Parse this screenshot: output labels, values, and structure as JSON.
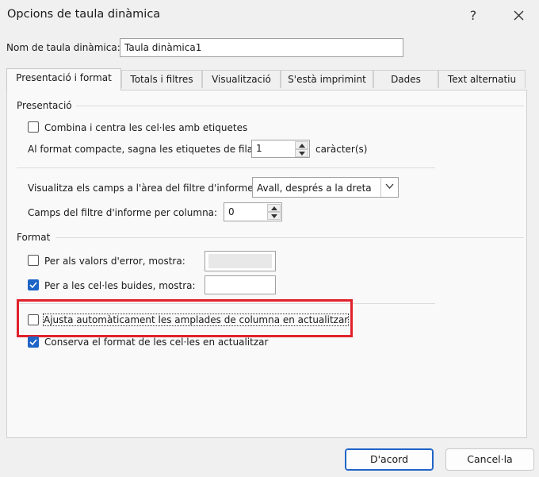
{
  "window": {
    "title": "Opcions de taula dinàmica",
    "help_label": "?"
  },
  "name_field": {
    "label": "Nom de taula dinàmica:",
    "value": "Taula dinàmica1"
  },
  "tabs": [
    {
      "label": "Presentació i format",
      "active": true
    },
    {
      "label": "Totals i filtres"
    },
    {
      "label": "Visualització"
    },
    {
      "label": "S'està imprimint"
    },
    {
      "label": "Dades"
    },
    {
      "label": "Text alternatiu"
    }
  ],
  "presentacio": {
    "title": "Presentació",
    "combine_label": "Combina i centra les cel·les amb etiquetes",
    "combine_checked": false,
    "compact_label": "Al format compacte, sagna les etiquetes de fila:",
    "compact_value": "1",
    "compact_unit": "caràcter(s)",
    "report_filter_label": "Visualitza els camps a l'àrea del filtre d'informe:",
    "report_filter_value": "Avall, després a la dreta",
    "fields_per_column_label": "Camps del filtre d'informe per columna:",
    "fields_per_column_value": "0"
  },
  "format": {
    "title": "Format",
    "error_label": "Per als valors d'error, mostra:",
    "error_checked": false,
    "error_value": "",
    "empty_label": "Per a les cel·les buides, mostra:",
    "empty_checked": true,
    "empty_value": "",
    "autofit_label": "Ajusta automàticament les amplades de columna en actualitzar",
    "autofit_checked": false,
    "preserve_label": "Conserva el format de les cel·les en actualitzar",
    "preserve_checked": true
  },
  "buttons": {
    "ok": "D'acord",
    "cancel": "Cancel·la"
  },
  "colors": {
    "accent": "#1f64c7",
    "highlight": "#e0212b"
  }
}
